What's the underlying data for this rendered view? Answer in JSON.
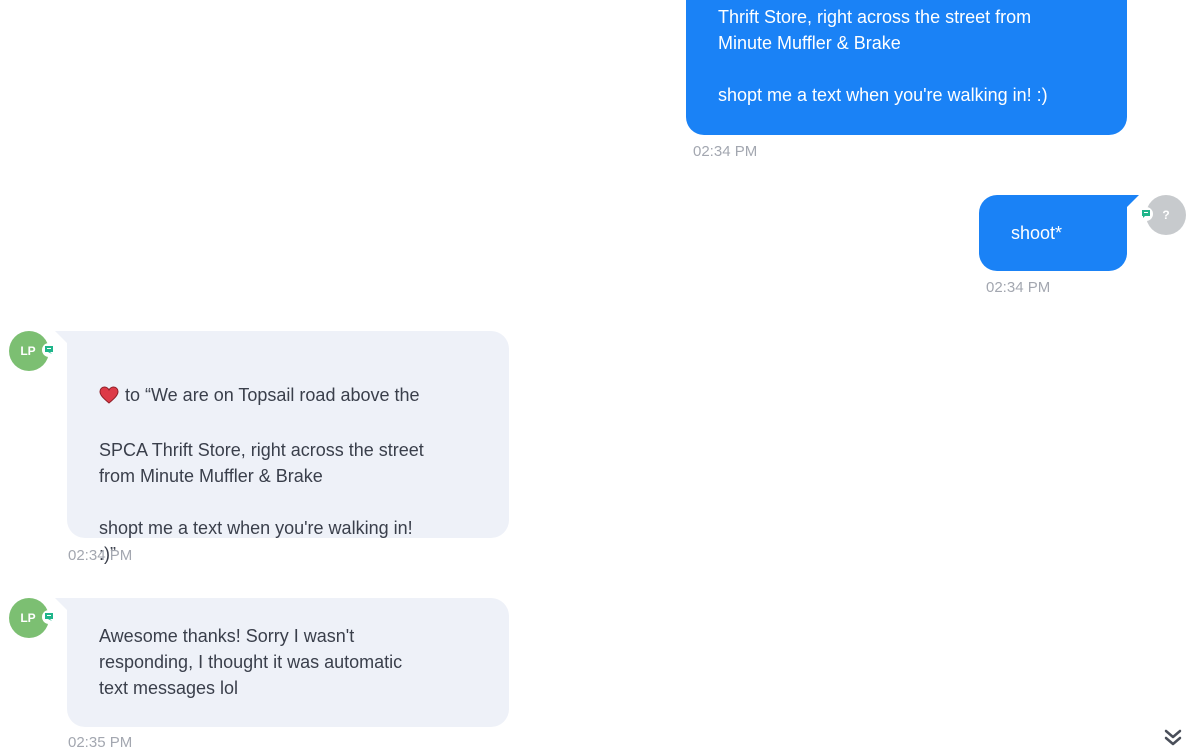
{
  "messages": [
    {
      "direction": "outgoing",
      "text": "Thrift Store, right across the street from\nMinute Muffler & Brake\n\nshopt me a text when you're walking in! :)",
      "time": "02:34 PM"
    },
    {
      "direction": "outgoing",
      "sender_initials": "?",
      "text": "shoot*",
      "time": "02:34 PM"
    },
    {
      "direction": "incoming",
      "sender_initials": "LP",
      "reaction_icon": "heart-icon",
      "reaction_prefix": "to “We are on Topsail road above the",
      "text": "SPCA Thrift Store, right across the street\nfrom Minute Muffler & Brake\n\nshopt me a text when you're walking in!\n:)”",
      "time": "02:34 PM"
    },
    {
      "direction": "incoming",
      "sender_initials": "LP",
      "text": "Awesome thanks! Sorry I wasn't\nresponding, I thought it was automatic\ntext messages lol",
      "time": "02:35 PM"
    }
  ],
  "colors": {
    "outgoing_bubble": "#1a82f6",
    "incoming_bubble": "#eef1f8",
    "avatar_lp": "#7cbf72",
    "avatar_unknown": "#c7cacd",
    "sms_badge": "#1fb58a",
    "timestamp": "#a3a7b0"
  }
}
